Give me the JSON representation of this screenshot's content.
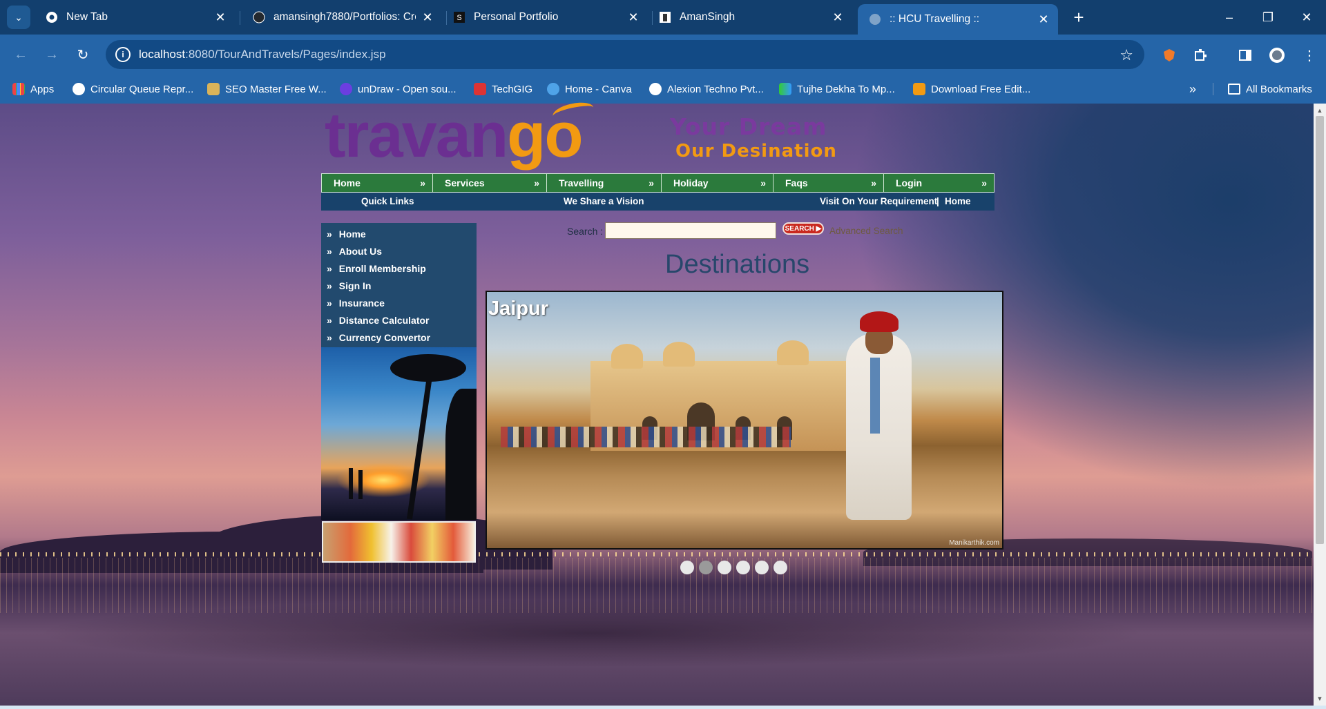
{
  "browser": {
    "tabs": [
      {
        "title": "New Tab",
        "icon": "chrome-icon",
        "active": false
      },
      {
        "title": "amansingh7880/Portfolios: Cre",
        "icon": "github-icon",
        "active": false
      },
      {
        "title": "Personal Portfolio",
        "icon": "portfolio-icon",
        "active": false
      },
      {
        "title": "AmanSingh",
        "icon": "profile-icon",
        "active": false
      },
      {
        "title": ":: HCU Travelling ::",
        "icon": "globe-icon",
        "active": true
      }
    ],
    "url_host": "localhost",
    "url_path": ":8080/TourAndTravels/Pages/index.jsp",
    "bookmarks": [
      {
        "label": "Apps",
        "icon": "apps-grid-icon"
      },
      {
        "label": "Circular Queue Repr...",
        "icon": "globe-icon"
      },
      {
        "label": "SEO Master Free W...",
        "icon": "seo-icon"
      },
      {
        "label": "unDraw - Open sou...",
        "icon": "undraw-icon"
      },
      {
        "label": "TechGIG",
        "icon": "techgig-icon"
      },
      {
        "label": "Home - Canva",
        "icon": "canva-icon"
      },
      {
        "label": "Alexion Techno Pvt...",
        "icon": "google-icon"
      },
      {
        "label": "Tujhe Dekha To Mp...",
        "icon": "audio-icon"
      },
      {
        "label": "Download Free Edit...",
        "icon": "download-icon"
      }
    ],
    "all_bookmarks": "All Bookmarks"
  },
  "site": {
    "logo_part1": "trava",
    "logo_part2": "n",
    "logo_part3": "go",
    "tagline1": "Your Dream",
    "tagline2": "Our Desination",
    "top_nav": [
      "Home",
      "Services",
      "Travelling",
      "Holiday",
      "Faqs",
      "Login"
    ],
    "nav_chevron": "»",
    "sub_nav": {
      "quick_links": "Quick Links",
      "vision": "We Share a Vision",
      "requirement": "Visit On Your Requirement",
      "separator": "|",
      "home": "Home"
    },
    "sidebar_links": [
      "Home",
      "About Us",
      "Enroll Membership",
      "Sign In",
      "Insurance",
      "Distance Calculator",
      "Currency Convertor"
    ],
    "search": {
      "label": "Search :",
      "value": "",
      "button": "SEARCH",
      "advanced": "Advanced Search"
    },
    "section_title": "Destinations",
    "slide": {
      "caption": "Jaipur",
      "watermark": "Manikarthik.com",
      "count": 6,
      "active_index": 1
    }
  }
}
